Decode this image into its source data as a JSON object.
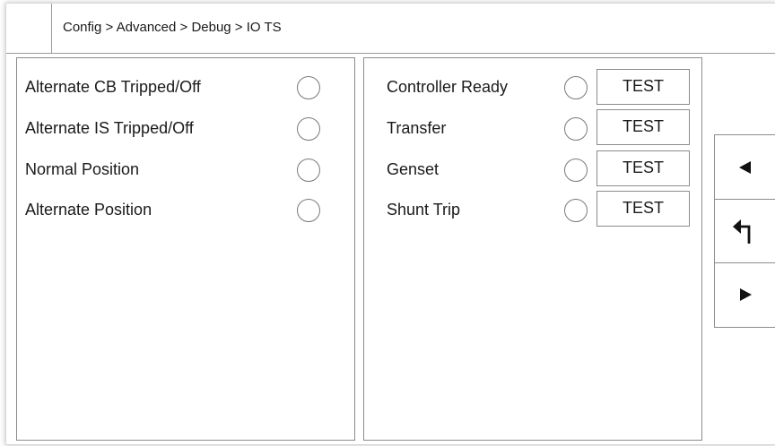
{
  "breadcrumb": {
    "text": "Config > Advanced > Debug > IO TS"
  },
  "left_panel": {
    "rows": [
      {
        "label": "Alternate CB Tripped/Off"
      },
      {
        "label": "Alternate IS Tripped/Off"
      },
      {
        "label": "Normal Position"
      },
      {
        "label": "Alternate Position"
      }
    ]
  },
  "right_panel": {
    "rows": [
      {
        "label": "Controller Ready",
        "button": "TEST"
      },
      {
        "label": "Transfer",
        "button": "TEST"
      },
      {
        "label": "Genset",
        "button": "TEST"
      },
      {
        "label": "Shunt Trip",
        "button": "TEST"
      }
    ]
  },
  "nav": {
    "icons": [
      "left-arrow-icon",
      "return-arrow-icon",
      "right-arrow-icon"
    ]
  }
}
